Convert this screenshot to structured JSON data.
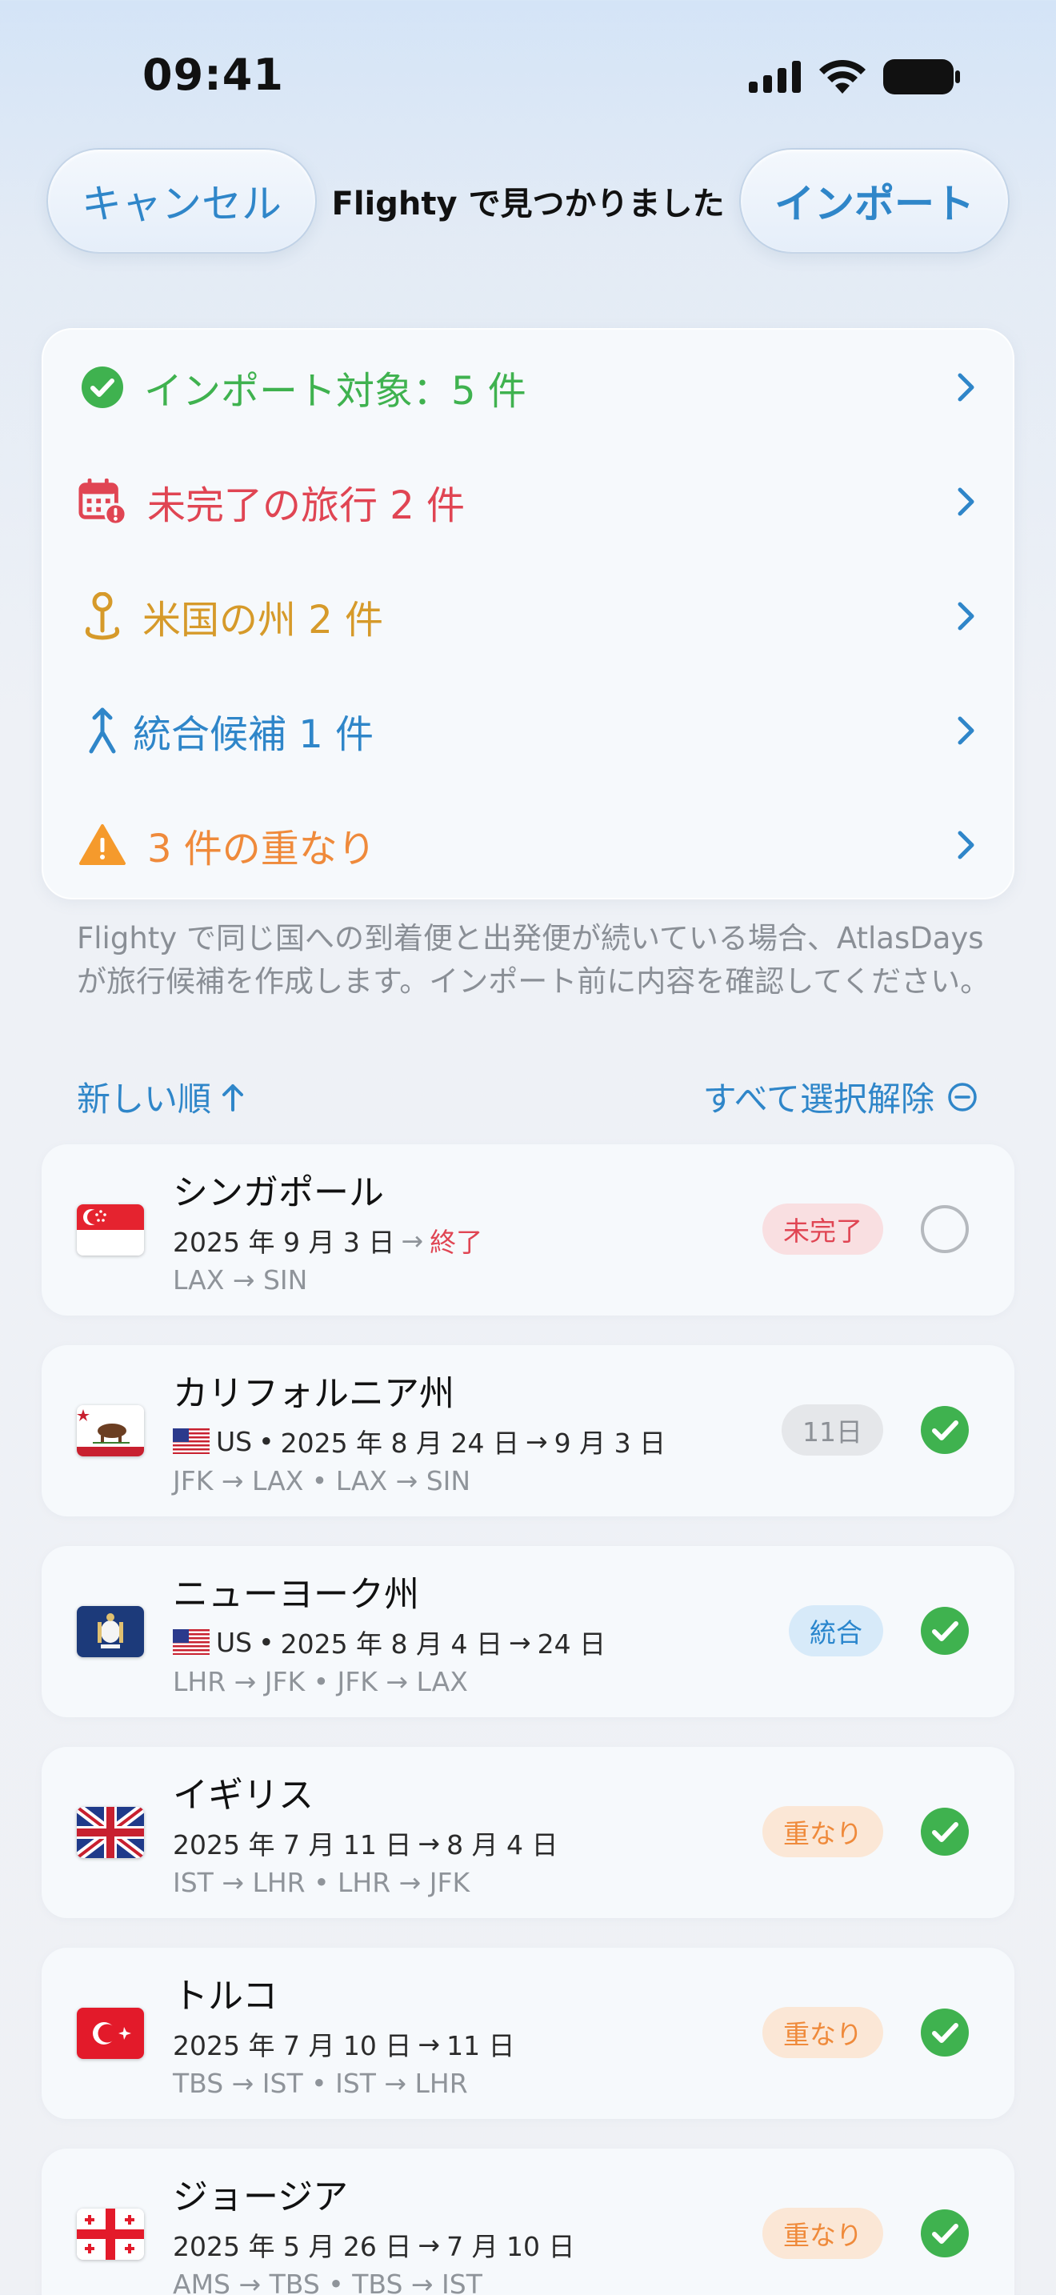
{
  "status": {
    "time": "09:41"
  },
  "nav": {
    "cancel_label": "キャンセル",
    "title": "Flighty で見つかりました",
    "import_label": "インポート"
  },
  "summary": {
    "rows": [
      {
        "label": "インポート対象：5 件",
        "color": "#3fb24f",
        "icon": "check-circle-icon"
      },
      {
        "label": "未完了の旅行 2 件",
        "color": "#e04553",
        "icon": "calendar-alert-icon"
      },
      {
        "label": "米国の州 2 件",
        "color": "#d69a2a",
        "icon": "map-pin-icon"
      },
      {
        "label": "統合候補 1 件",
        "color": "#2f86c9",
        "icon": "merge-arrow-icon"
      },
      {
        "label": "3 件の重なり",
        "color": "#ef8a3b",
        "icon": "warning-triangle-icon"
      }
    ]
  },
  "footnote": "Flighty で同じ国への到着便と出発便が続いている場合、AtlasDays が旅行候補を作成します。インポート前に内容を確認してください。",
  "sort": {
    "order_label": "新しい順",
    "deselect_label": "すべて選択解除"
  },
  "trips": [
    {
      "name": "シンガポール",
      "date_start": "2025 年 9 月 3 日",
      "date_end": "終了",
      "country_code": "",
      "route": "LAX → SIN",
      "badge": "未完了",
      "badge_style": "red",
      "selected": false,
      "flag": "singapore-flag"
    },
    {
      "name": "カリフォルニア州",
      "date_start": "2025 年 8 月 24 日",
      "date_end": "9 月 3 日",
      "country_code": "US",
      "route": "JFK → LAX • LAX → SIN",
      "badge": "11日",
      "badge_style": "gray",
      "selected": true,
      "flag": "california-flag"
    },
    {
      "name": "ニューヨーク州",
      "date_start": "2025 年 8 月 4 日",
      "date_end": "24 日",
      "country_code": "US",
      "route": "LHR → JFK • JFK → LAX",
      "badge": "統合",
      "badge_style": "blue",
      "selected": true,
      "flag": "new-york-flag"
    },
    {
      "name": "イギリス",
      "date_start": "2025 年 7 月 11 日",
      "date_end": "8 月 4 日",
      "country_code": "",
      "route": "IST → LHR • LHR → JFK",
      "badge": "重なり",
      "badge_style": "orange",
      "selected": true,
      "flag": "uk-flag"
    },
    {
      "name": "トルコ",
      "date_start": "2025 年 7 月 10 日",
      "date_end": "11 日",
      "country_code": "",
      "route": "TBS → IST • IST → LHR",
      "badge": "重なり",
      "badge_style": "orange",
      "selected": true,
      "flag": "turkey-flag"
    },
    {
      "name": "ジョージア",
      "date_start": "2025 年 5 月 26 日",
      "date_end": "7 月 10 日",
      "country_code": "",
      "route": "AMS → TBS • TBS → IST",
      "badge": "重なり",
      "badge_style": "orange",
      "selected": true,
      "flag": "georgia-flag"
    }
  ]
}
